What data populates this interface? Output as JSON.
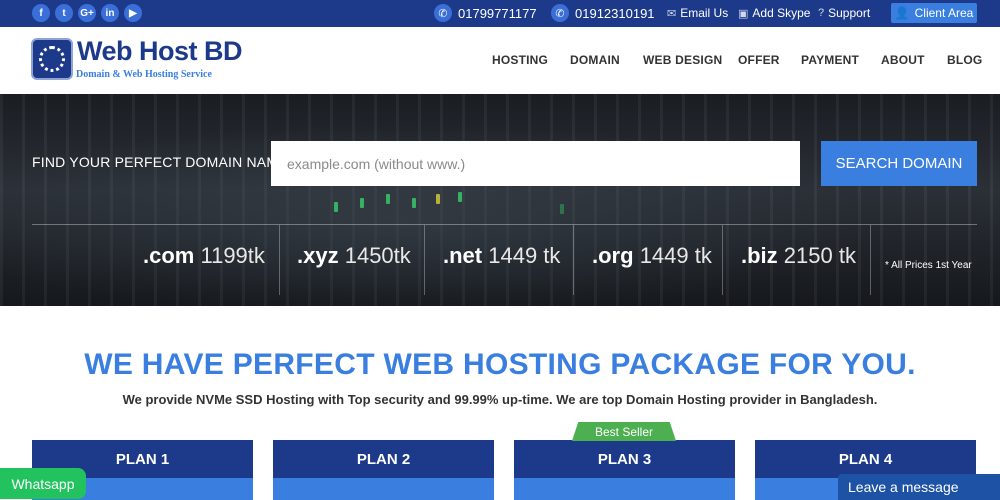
{
  "topbar": {
    "social": [
      {
        "icon": "facebook-icon",
        "glyph": "f"
      },
      {
        "icon": "twitter-icon",
        "glyph": "t"
      },
      {
        "icon": "google-plus-icon",
        "glyph": "G+"
      },
      {
        "icon": "linkedin-icon",
        "glyph": "in"
      },
      {
        "icon": "youtube-icon",
        "glyph": "▶"
      }
    ],
    "phone1": "01799771177",
    "phone2": "01912310191",
    "email_label": "Email Us",
    "skype_label": "Add Skype",
    "support_label": "Support",
    "client_label": "Client Area"
  },
  "nav": {
    "logo_title": "Web Host BD",
    "logo_sub": "Domain & Web Hosting Service",
    "menu": [
      "HOSTING",
      "DOMAIN",
      "WEB DESIGN",
      "OFFER",
      "PAYMENT",
      "ABOUT",
      "BLOG"
    ]
  },
  "hero": {
    "find_label": "FIND YOUR PERFECT DOMAIN NAME:",
    "search_placeholder": "example.com (without www.)",
    "search_button": "SEARCH DOMAIN",
    "tlds": [
      {
        "ext": ".com",
        "price": "1199tk"
      },
      {
        "ext": ".xyz",
        "price": "1450tk"
      },
      {
        "ext": ".net",
        "price": "1449 tk"
      },
      {
        "ext": ".org",
        "price": "1449 tk"
      },
      {
        "ext": ".biz",
        "price": "2150 tk"
      }
    ],
    "note": "* All Prices 1st Year"
  },
  "section": {
    "headline": "WE HAVE PERFECT WEB HOSTING PACKAGE FOR YOU.",
    "subline": "We provide NVMe SSD Hosting with Top security and 99.99% up-time. We are top Domain Hosting provider in Bangladesh.",
    "plans": [
      "PLAN 1",
      "PLAN 2",
      "PLAN 3",
      "PLAN 4"
    ],
    "best_seller": "Best Seller"
  },
  "widgets": {
    "whatsapp": "Whatsapp",
    "leave_message": "Leave a message"
  },
  "colors": {
    "navy": "#1d3a8a",
    "accent": "#3a7fe0",
    "green": "#4caf50"
  }
}
